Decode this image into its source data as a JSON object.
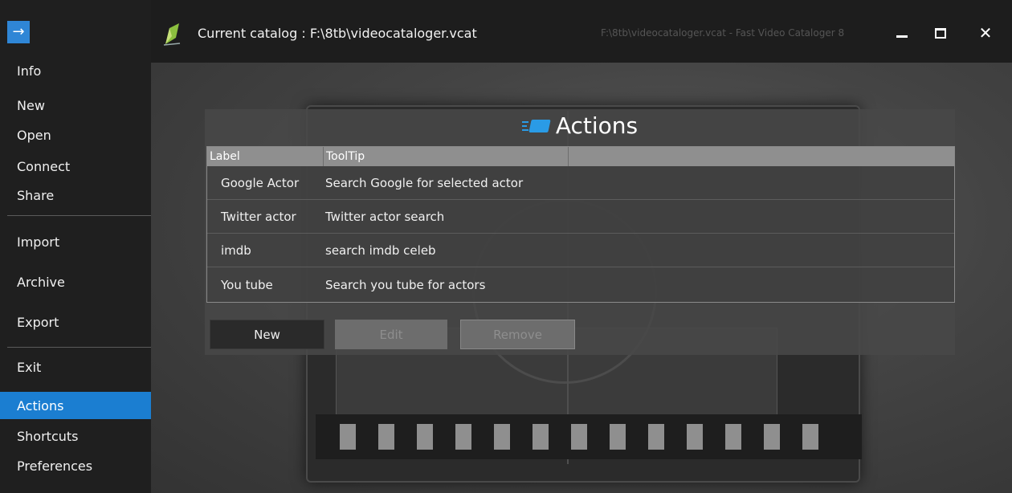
{
  "sidebar": {
    "back_glyph": "→",
    "items": [
      {
        "label": "Info"
      },
      {
        "label": "New"
      },
      {
        "label": "Open"
      },
      {
        "label": "Connect"
      },
      {
        "label": "Share"
      },
      {
        "label": "Import"
      },
      {
        "label": "Archive"
      },
      {
        "label": "Export"
      },
      {
        "label": "Exit"
      },
      {
        "label": "Actions"
      },
      {
        "label": "Shortcuts"
      },
      {
        "label": "Preferences"
      }
    ],
    "active_item": "Actions"
  },
  "titlebar": {
    "catalog_title": "Current catalog : F:\\8tb\\videocataloger.vcat",
    "window_title": "F:\\8tb\\videocataloger.vcat - Fast Video Cataloger 8",
    "close_glyph": "✕"
  },
  "actions_panel": {
    "title": "Actions",
    "columns": [
      "Label",
      "ToolTip"
    ],
    "rows": [
      {
        "label": "Google Actor",
        "tooltip": "Search Google for selected actor"
      },
      {
        "label": "Twitter actor",
        "tooltip": "Twitter actor search"
      },
      {
        "label": "imdb",
        "tooltip": "search imdb celeb"
      },
      {
        "label": "You tube",
        "tooltip": "Search you tube for actors"
      }
    ],
    "buttons": {
      "new": "New",
      "edit": "Edit",
      "remove": "Remove"
    }
  },
  "colors": {
    "accent": "#1b7ed1",
    "sidebar_bg": "#1f1f1f"
  }
}
